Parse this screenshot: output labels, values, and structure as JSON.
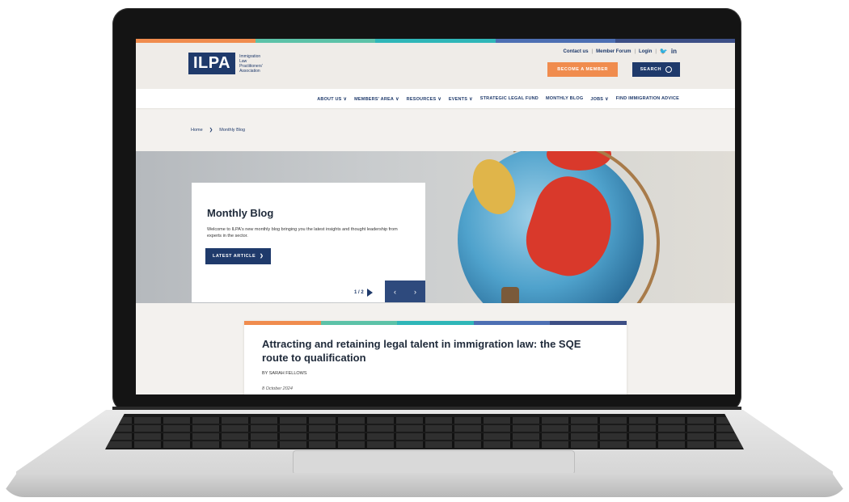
{
  "colors": {
    "stripe": [
      "#f08c4e",
      "#5cc2a8",
      "#2fb6b8",
      "#4d6fb3",
      "#3d4f86"
    ],
    "navy": "#1f3a6b",
    "orange": "#f08c4e"
  },
  "header": {
    "logo_text": "ILPA",
    "logo_subtitle": "Immigration Law Practitioners' Association",
    "top_links": [
      "Contact us",
      "Member Forum",
      "Login"
    ],
    "social_icons": [
      "twitter-icon",
      "linkedin-icon"
    ],
    "twitter_glyph": "🐦",
    "linkedin_glyph": "in",
    "become_member_label": "BECOME A MEMBER",
    "search_label": "SEARCH"
  },
  "nav": {
    "items": [
      {
        "label": "ABOUT US",
        "dropdown": true
      },
      {
        "label": "MEMBERS' AREA",
        "dropdown": true
      },
      {
        "label": "RESOURCES",
        "dropdown": true
      },
      {
        "label": "EVENTS",
        "dropdown": true
      },
      {
        "label": "STRATEGIC LEGAL FUND",
        "dropdown": false
      },
      {
        "label": "MONTHLY BLOG",
        "dropdown": false
      },
      {
        "label": "JOBS",
        "dropdown": true
      },
      {
        "label": "FIND IMMIGRATION ADVICE",
        "dropdown": false
      }
    ],
    "chevron": "∨"
  },
  "breadcrumb": {
    "home": "Home",
    "separator": "❯",
    "current": "Monthly Blog"
  },
  "hero": {
    "title": "Monthly Blog",
    "description": "Welcome to ILPA's new monthly blog bringing you the latest insights and thought leadership from experts in the sector.",
    "button_label": "LATEST ARTICLE",
    "button_arrow": "❯",
    "pager_text": "1 / 2",
    "prev_glyph": "‹",
    "next_glyph": "›"
  },
  "article": {
    "title": "Attracting and retaining legal talent in immigration law: the SQE route to qualification",
    "byline": "BY SARAH FELLOWS",
    "date": "8 October 2024"
  }
}
